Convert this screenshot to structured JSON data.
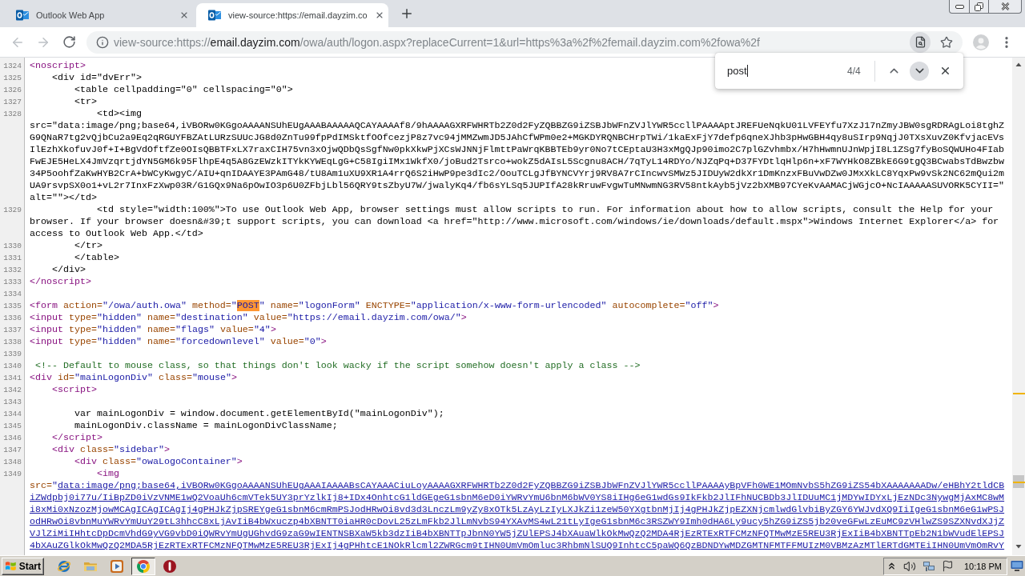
{
  "tabs": [
    {
      "title": "Outlook Web App",
      "selected": false
    },
    {
      "title": "view-source:https://email.dayzim.co",
      "selected": true
    }
  ],
  "navigation": {
    "back": {
      "disabled": true
    },
    "forward": {
      "disabled": true
    }
  },
  "address_bar": {
    "prefix": "view-source:https://",
    "host": "email.dayzim.com",
    "path": "/owa/auth/logon.aspx?replaceCurrent=1&url=https%3a%2f%2femail.dayzim.com%2fowa%2f"
  },
  "find_bar": {
    "value": "post",
    "count": "4/4"
  },
  "source": [
    {
      "number": "1324",
      "tokens": [
        {
          "kind": "tag",
          "text": "<noscript>"
        }
      ]
    },
    {
      "number": "1325",
      "tokens": [
        {
          "kind": "text",
          "text": "    <div id=\"dvErr\">"
        }
      ]
    },
    {
      "number": "1326",
      "tokens": [
        {
          "kind": "text",
          "text": "        <table cellpadding=\"0\" cellspacing=\"0\">"
        }
      ]
    },
    {
      "number": "1327",
      "tokens": [
        {
          "kind": "text",
          "text": "        <tr>"
        }
      ]
    },
    {
      "number": "1328",
      "tokens": [
        {
          "kind": "text",
          "text": "            <td><img src=\"data:image/png;base64,iVBORw0KGgoAAAANSUhEUgAAABAAAAAQCAYAAAAf8/9hAAAAGXRFWHRTb2Z0d2FyZQBBZG9iZSBJbWFnZVJlYWR5ccllPAAAAptJREFUeNqkU01LVFEYfu7XzJ17nZmyJBW0sgRDRAgLoi8tghZG9QNaR7tg2vQjbCu2a9Eq2qRGUYFBZAtLURzSUUcJG8d0ZnTu99fpPdIMSktfOOfcezjP8z7vc94jMMZwmJD5JAhCfWPm0e2+MGKDYRQNBCHrpTWi/1kaExFjY7defp6qneXJhb3pHwGBH4qy8uSIrp9NqjJ0TXsXuvZ0KfvjacEVsIlEzhXkofuvJ0f+I+BgVdOftfZe0OIsQBBTFxLX7raxCIH75vn3xOjwQDbQsSgfNw0pkXkwPjXCsWJNNjFlmttPaWrqKBBTEb9yr0No7tCEptaU3H3xMgQJp90imo2C7plGZvhmbx/H7hHwmnUJnWpjI8L1ZSg7fyBoSQWUHo4FIabFwEJE5HeLX4JmVzqrtjdYN5GM6k95FlhpE4q5A8GzEWzkITYkKYWEqLgG+C58IgiIMx1WkfX0/joBud2Tsrco+wokZ5dAIsL5Scgnu8ACH/7qTyL14RDYo/NJZqPq+D37FYDtlqHlp6n+xF7WYHkO8ZBkE6G9tgQ3BCwabsTdBwzbw34P5oohfZaKwHYB2CrA+bWCyKwgyC/AIU+qnIDAAYE3PAmG48/tU8Am1uXU9XR1A4rrQ6S2iHwP9pe3dIc2/OouTCLgJfBYNCVYrj9RV8A7rCIncwvSMWz5JIDUyW2dkXr1DmKnzxFBuVwDZw0JMxXkLC8YqxPw9vSk2NC62mQui2mUA9rsvpSX0o1+vL2r7InxFzXwp03R/G1GQx9Na6pOwIO3p6U0ZFbjLbl56QRY9tsZbyU7W/jwalyKq4/fb6sYLSq5JUPIfA28kRruwFvgwTuMNwmNG3RV58ntkAyb5jVz2bXMB97CYeKvAAMACjWGjcO+NcIAAAAASUVORK5CYII=\" alt=\"\"></td>"
        }
      ]
    },
    {
      "number": "1329",
      "tokens": [
        {
          "kind": "text",
          "text": "            <td style=\"width:100%\">To use Outlook Web App, browser settings must allow scripts to run. For information about how to allow scripts, consult the Help for your browser. If your browser doesn&#39;t support scripts, you can download <a href=\"http://www.microsoft.com/windows/ie/downloads/default.mspx\">Windows Internet Explorer</a> for access to Outlook Web App.</td>"
        }
      ]
    },
    {
      "number": "1330",
      "tokens": [
        {
          "kind": "text",
          "text": "        </tr>"
        }
      ]
    },
    {
      "number": "1331",
      "tokens": [
        {
          "kind": "text",
          "text": "        </table>"
        }
      ]
    },
    {
      "number": "1332",
      "tokens": [
        {
          "kind": "text",
          "text": "    </div>"
        }
      ]
    },
    {
      "number": "1333",
      "tokens": [
        {
          "kind": "tag",
          "text": "</noscript>"
        }
      ]
    },
    {
      "number": "1334"
    },
    {
      "number": "1335",
      "tokens": [
        {
          "kind": "tag",
          "text": "<form"
        },
        {
          "kind": "attr",
          "text": " action="
        },
        {
          "kind": "value",
          "text": "\"/owa/auth.owa\""
        },
        {
          "kind": "attr",
          "text": " method="
        },
        {
          "kind": "value",
          "text": "\""
        },
        {
          "kind": "value",
          "text": "POST",
          "current_match": true
        },
        {
          "kind": "value",
          "text": "\""
        },
        {
          "kind": "attr",
          "text": " name="
        },
        {
          "kind": "value",
          "text": "\"logonForm\""
        },
        {
          "kind": "attr",
          "text": " ENCTYPE="
        },
        {
          "kind": "value",
          "text": "\"application/x-www-form-urlencoded\""
        },
        {
          "kind": "attr",
          "text": " autocomplete="
        },
        {
          "kind": "value",
          "text": "\"off\""
        },
        {
          "kind": "tag",
          "text": ">"
        }
      ]
    },
    {
      "number": "1336",
      "tokens": [
        {
          "kind": "tag",
          "text": "<input"
        },
        {
          "kind": "attr",
          "text": " type="
        },
        {
          "kind": "value",
          "text": "\"hidden\""
        },
        {
          "kind": "attr",
          "text": " name="
        },
        {
          "kind": "value",
          "text": "\"destination\""
        },
        {
          "kind": "attr",
          "text": " value="
        },
        {
          "kind": "value",
          "text": "\"https://email.dayzim.com/owa/\""
        },
        {
          "kind": "tag",
          "text": ">"
        }
      ]
    },
    {
      "number": "1337",
      "tokens": [
        {
          "kind": "tag",
          "text": "<input"
        },
        {
          "kind": "attr",
          "text": " type="
        },
        {
          "kind": "value",
          "text": "\"hidden\""
        },
        {
          "kind": "attr",
          "text": " name="
        },
        {
          "kind": "value",
          "text": "\"flags\""
        },
        {
          "kind": "attr",
          "text": " value="
        },
        {
          "kind": "value",
          "text": "\"4\""
        },
        {
          "kind": "tag",
          "text": ">"
        }
      ]
    },
    {
      "number": "1338",
      "tokens": [
        {
          "kind": "tag",
          "text": "<input"
        },
        {
          "kind": "attr",
          "text": " type="
        },
        {
          "kind": "value",
          "text": "\"hidden\""
        },
        {
          "kind": "attr",
          "text": " name="
        },
        {
          "kind": "value",
          "text": "\"forcedownlevel\""
        },
        {
          "kind": "attr",
          "text": " value="
        },
        {
          "kind": "value",
          "text": "\"0\""
        },
        {
          "kind": "tag",
          "text": ">"
        }
      ]
    },
    {
      "number": "1339"
    },
    {
      "number": "1340",
      "tokens": [
        {
          "kind": "comment",
          "text": " <!-- Default to mouse class, so that things don't look wacky if the script somehow doesn't apply a class -->"
        }
      ]
    },
    {
      "number": "1341",
      "tokens": [
        {
          "kind": "tag",
          "text": "<div"
        },
        {
          "kind": "attr",
          "text": " id="
        },
        {
          "kind": "value",
          "text": "\"mainLogonDiv\""
        },
        {
          "kind": "attr",
          "text": " class="
        },
        {
          "kind": "value",
          "text": "\"mouse\""
        },
        {
          "kind": "tag",
          "text": ">"
        }
      ]
    },
    {
      "number": "1342",
      "tokens": [
        {
          "kind": "tag",
          "text": "    <script>"
        }
      ]
    },
    {
      "number": "1343"
    },
    {
      "number": "1344",
      "tokens": [
        {
          "kind": "text",
          "text": "        var mainLogonDiv = window.document.getElementById(\"mainLogonDiv\");"
        }
      ]
    },
    {
      "number": "1345",
      "tokens": [
        {
          "kind": "text",
          "text": "        mainLogonDiv.className = mainLogonDivClassName;"
        }
      ]
    },
    {
      "number": "1346",
      "tokens": [
        {
          "kind": "tag",
          "text": "    </script>"
        }
      ]
    },
    {
      "number": "1347",
      "tokens": [
        {
          "kind": "tag",
          "text": "    <div"
        },
        {
          "kind": "attr",
          "text": " class="
        },
        {
          "kind": "value",
          "text": "\"sidebar\""
        },
        {
          "kind": "tag",
          "text": ">"
        }
      ]
    },
    {
      "number": "1348",
      "tokens": [
        {
          "kind": "tag",
          "text": "        <div"
        },
        {
          "kind": "attr",
          "text": " class="
        },
        {
          "kind": "value",
          "text": "\"owaLogoContainer\""
        },
        {
          "kind": "tag",
          "text": ">"
        }
      ]
    },
    {
      "number": "1349",
      "tokens": [
        {
          "kind": "tag",
          "text": "            <img"
        },
        {
          "kind": "attr",
          "text": " src="
        },
        {
          "kind": "value",
          "text": "\""
        },
        {
          "kind": "link",
          "text": "data:image/png;base64,iVBORw0KGgoAAAANSUhEUgAAAIAAAABsCAYAAACiuLoyAAAAGXRFWHRTb2Z0d2FyZQBBZG9iZSBJbWFnZVJlYWR5ccllPAAAAyBpVFh0WE1MOmNvbS5hZG9iZS54bXAAAAAAADw/eHBhY2tldCBiZWdpbj0i77u/IiBpZD0iVzVNME1wQ2VoaUh6cmVTek5UY3prYzlkIj8+IDx4OnhtcG1ldGEgeG1sbnM6eD0iYWRvYmU6bnM6bWV0YS8iIHg6eG1wdGs9IkFkb2JlIFhNUCBDb3JlIDUuMC1jMDYwIDYxLjEzNDc3NywgMjAxMC8wMi8xMi0xNzozMjowMCAgICAgICAgIj4gPHJkZjpSREYgeG1sbnM6cmRmPSJodHRwOi8vd3d3LnczLm9yZy8xOTk5LzAyLzIyLXJkZi1zeW50YXgtbnMjIj4gPHJkZjpEZXNjcmlwdGlvbiByZGY6YWJvdXQ9IiIgeG1sbnM6eG1wPSJodHRwOi8vbnMuYWRvYmUuY29tL3hhcC8xLjAvIiB4bWxuczp4bXBNTT0iaHR0cDovL25zLmFkb2JlLmNvbS94YXAvMS4wL21tLyIgeG1sbnM6c3RSZWY9Imh0dHA6Ly9ucy5hZG9iZS5jb20veGFwLzEuMC9zVHlwZS9SZXNvdXJjZVJlZiMiIHhtcDpDcmVhdG9yVG9vbD0iQWRvYmUgUGhvdG9zaG9wIENTNSBXaW5kb3dzIiB4bXBNTTpJbnN0YW5jZUlEPSJ4bXAuaWlkOkMwQzQ2MDA4RjEzRTExRTFCMzNFQTMwMzE5REU3RjExIiB4bXBNTTpEb2N1bWVudElEPSJ4bXAuZGlkOkMwQzQ2MDA5RjEzRTExRTFCMzNFQTMwMzE5REU3RjExIj4gPHhtcE1NOkRlcml2ZWRGcm9tIHN0UmVmOmluc3RhbmNlSUQ9InhtcC5paWQ6QzBDNDYwMDZGMTNFMTFFMUIzM0VBMzAzMTlERTdGMTEiIHN0UmVmOmRvY"
        }
      ]
    }
  ],
  "taskbar": {
    "start": "Start",
    "buttons": [
      {
        "selected": false
      },
      {
        "selected": false
      },
      {
        "selected": false
      },
      {
        "selected": true
      },
      {
        "selected": false
      }
    ],
    "clock": "10:18 PM"
  }
}
